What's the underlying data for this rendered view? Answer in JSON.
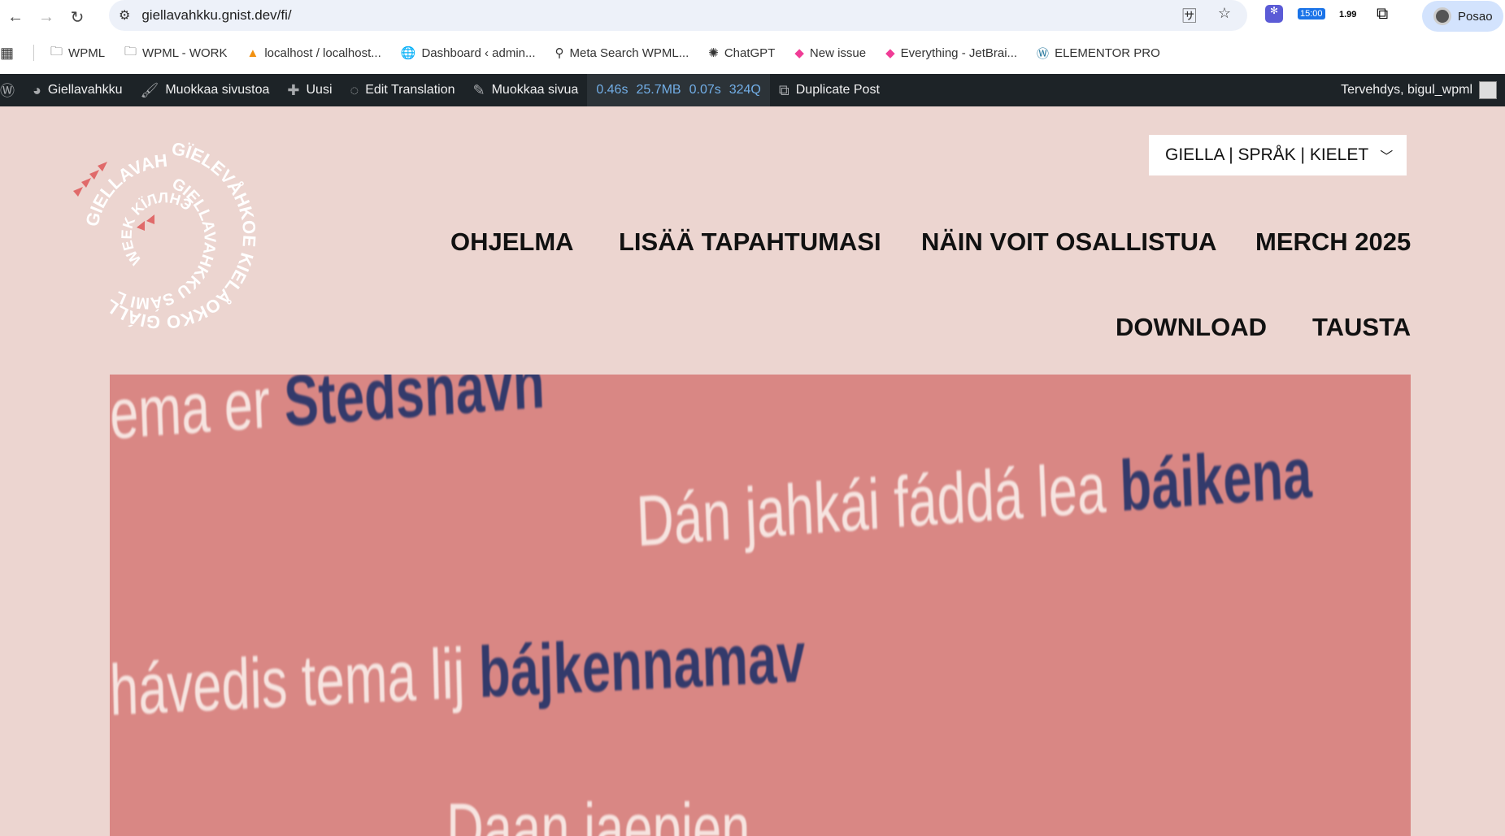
{
  "browser": {
    "url": "giellavahkku.gnist.dev/fi/",
    "profile": "Posao",
    "ext_timer": "15:00",
    "ext_price": "1.99",
    "bookmarks": [
      {
        "label": "WPML",
        "icon": "folder-icon"
      },
      {
        "label": "WPML - WORK",
        "icon": "folder-icon"
      },
      {
        "label": "localhost / localhost...",
        "icon": "phpmyadmin-icon"
      },
      {
        "label": "Dashboard ‹ admin...",
        "icon": "globe-icon"
      },
      {
        "label": "Meta Search WPML...",
        "icon": "search-icon"
      },
      {
        "label": "ChatGPT",
        "icon": "chatgpt-icon"
      },
      {
        "label": "New issue",
        "icon": "jetbrains-icon"
      },
      {
        "label": "Everything - JetBrai...",
        "icon": "jetbrains-icon"
      },
      {
        "label": "ELEMENTOR PRO",
        "icon": "wordpress-icon"
      }
    ]
  },
  "adminbar": {
    "site": "Giellavahkku",
    "customize": "Muokkaa sivustoa",
    "new": "Uusi",
    "edit_translation": "Edit Translation",
    "edit_page": "Muokkaa sivua",
    "perf": [
      "0.46s",
      "25.7MB",
      "0.07s",
      "324Q"
    ],
    "duplicate": "Duplicate Post",
    "greeting": "Tervehdys, bigul_wpml"
  },
  "logo": {
    "text": "GÏELEVÅHKOE KIELÅOKKO GIÁLLAVAHKKU GIELLAVAHKKO GIELLAVAHKKU SÁMI LANGUAGE WEEK KЇЛЛНЭДТЭЛЬ KÏLLNEDTEL / KÏLLNEÅTTEL"
  },
  "header": {
    "language_switcher": "GIELLA | SPRÅK | KIELET",
    "nav": [
      "OHJELMA",
      "LISÄÄ TAPAHTUMASI",
      "NÄIN VOIT OSALLISTUA",
      "MERCH 2025",
      "DOWNLOAD",
      "TAUSTA"
    ]
  },
  "banner": {
    "lines": [
      {
        "light": "ema er ",
        "dark": "Stedsnavn"
      },
      {
        "light": "Dán jahkái fáddá lea ",
        "dark": "báikena"
      },
      {
        "light": "hávedis tema lij ",
        "dark": "bájkennamav"
      },
      {
        "light": "Daan jaepien",
        "dark": ""
      }
    ]
  }
}
